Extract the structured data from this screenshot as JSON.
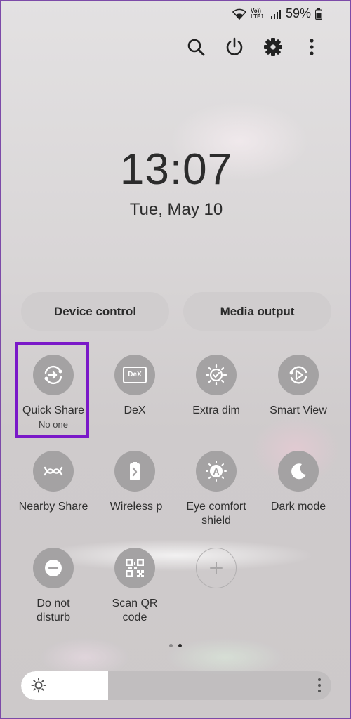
{
  "status_bar": {
    "icons": [
      "wifi-icon",
      "volte-lte-icon",
      "signal-icon",
      "battery-icon"
    ],
    "volte_label": "Vo)) LTE1",
    "battery_text": "59%"
  },
  "top_icons": [
    "search-icon",
    "power-icon",
    "settings-icon",
    "more-options-icon"
  ],
  "clock": {
    "time": "13:07",
    "date": "Tue, May 10"
  },
  "buttons": {
    "device_control": "Device control",
    "media_output": "Media output"
  },
  "tiles": [
    {
      "icon": "quick-share-icon",
      "label": "Quick Share",
      "sub": "No one",
      "highlighted": true
    },
    {
      "icon": "dex-icon",
      "label": "DeX",
      "icon_text": "DeX"
    },
    {
      "icon": "extra-dim-icon",
      "label": "Extra dim"
    },
    {
      "icon": "smart-view-icon",
      "label": "Smart View"
    },
    {
      "icon": "nearby-share-icon",
      "label": "Nearby Share"
    },
    {
      "icon": "wireless-powershare-icon",
      "label": "Wireless p"
    },
    {
      "icon": "eye-comfort-shield-icon",
      "label": "Eye comfort\nshield",
      "icon_text": "A"
    },
    {
      "icon": "dark-mode-icon",
      "label": "Dark mode"
    },
    {
      "icon": "do-not-disturb-icon",
      "label": "Do not\ndisturb"
    },
    {
      "icon": "qr-code-icon",
      "label": "Scan QR\ncode"
    },
    {
      "icon": "add-tile-icon",
      "label": ""
    }
  ],
  "pager": {
    "pages": 2,
    "current": 2
  },
  "brightness": {
    "level": 0.28,
    "icon": "sun-icon",
    "menu_icon": "more-vertical-icon"
  },
  "colors": {
    "highlight": "#7a18c8",
    "tile": "#a4a2a3",
    "text": "#2c2c2c"
  }
}
